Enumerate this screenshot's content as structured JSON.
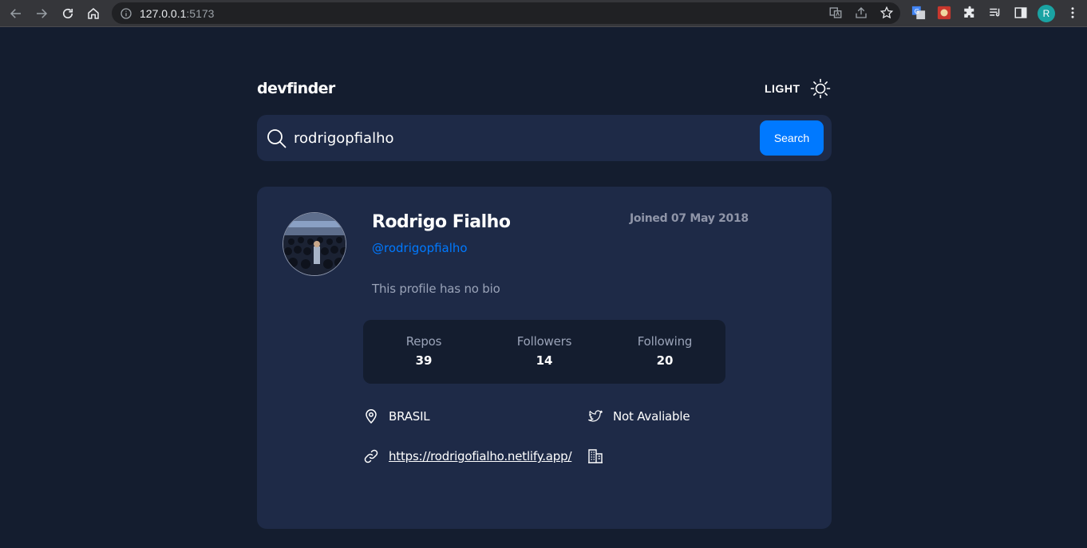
{
  "browser": {
    "url_host": "127.0.0.1",
    "url_port": ":5173",
    "profile_initial": "R"
  },
  "header": {
    "app_title": "devfinder",
    "theme_label": "LIGHT"
  },
  "search": {
    "value": "rodrigopfialho",
    "button_label": "Search"
  },
  "profile": {
    "name": "Rodrigo Fialho",
    "login": "@rodrigopfialho",
    "joined": "Joined 07 May 2018",
    "bio": "This profile has no bio"
  },
  "stats": [
    {
      "label": "Repos",
      "value": "39"
    },
    {
      "label": "Followers",
      "value": "14"
    },
    {
      "label": "Following",
      "value": "20"
    }
  ],
  "links": {
    "location": "BRASIL",
    "twitter": "Not Avaliable",
    "blog": "https://rodrigofialho.netlify.app/",
    "company": ""
  },
  "colors": {
    "background": "#141d2f",
    "card": "#1e2a47",
    "accent": "#0079ff"
  }
}
